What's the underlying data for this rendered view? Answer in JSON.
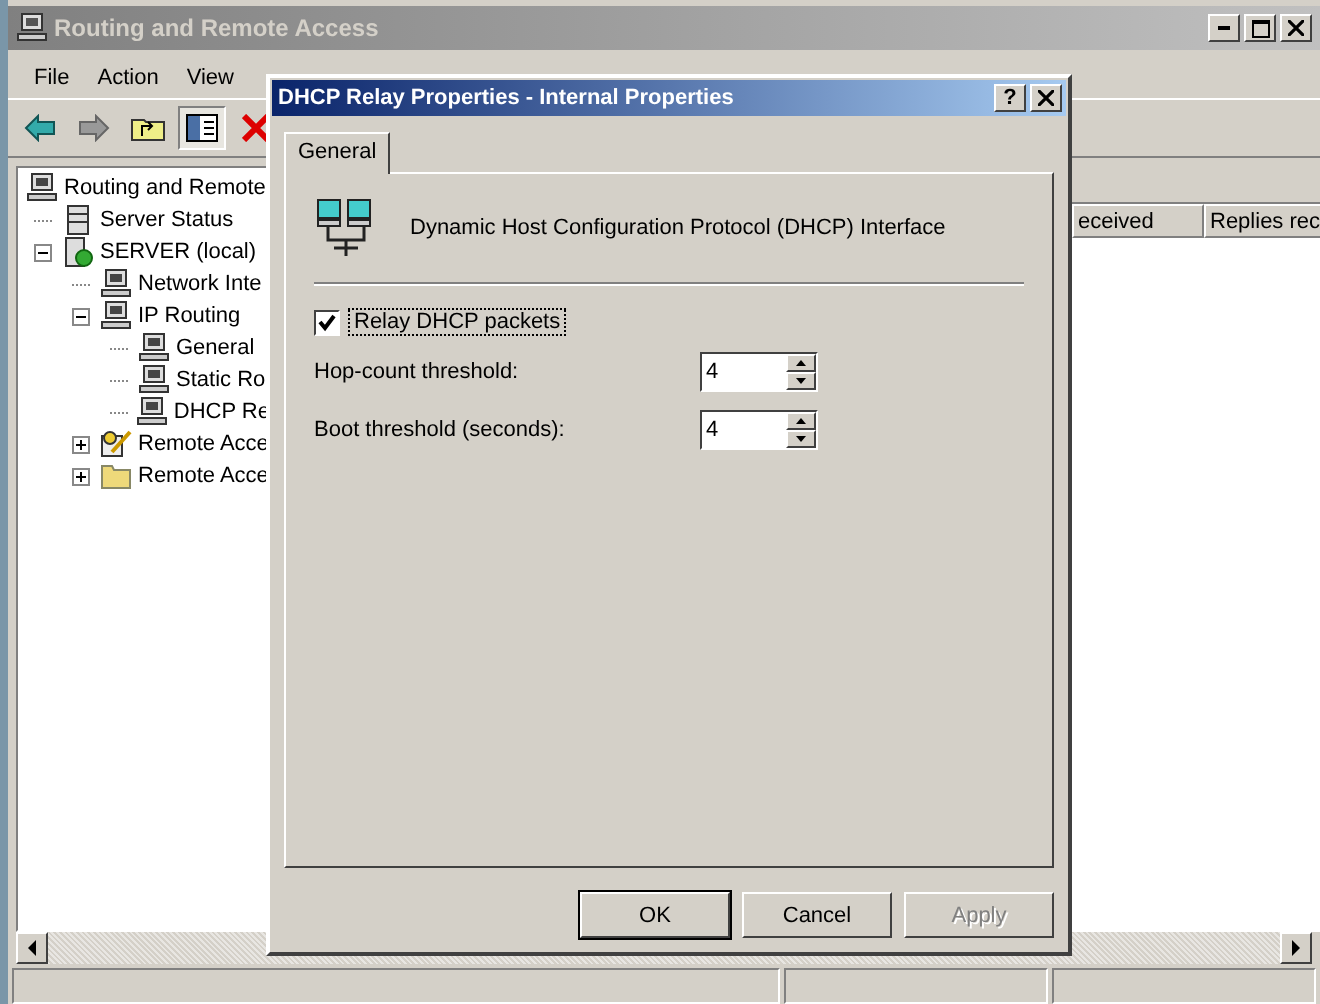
{
  "main_window": {
    "title": "Routing and Remote Access"
  },
  "menu": [
    "File",
    "Action",
    "View"
  ],
  "toolbar": [
    {
      "kind": "back",
      "pressed": false
    },
    {
      "kind": "forward",
      "pressed": false
    },
    {
      "kind": "up",
      "pressed": false
    },
    {
      "kind": "tree",
      "pressed": true
    },
    {
      "kind": "delete",
      "pressed": false
    }
  ],
  "tree": [
    {
      "label": "Routing and Remote",
      "kind": "computer",
      "children": [
        {
          "label": "Server Status",
          "kind": "status"
        },
        {
          "label": "SERVER (local)",
          "kind": "server",
          "expanded": true,
          "children": [
            {
              "label": "Network Inte",
              "kind": "computer"
            },
            {
              "label": "IP Routing",
              "kind": "computer",
              "expanded": true,
              "children": [
                {
                  "label": "General",
                  "kind": "computer"
                },
                {
                  "label": "Static Ro",
                  "kind": "computer"
                },
                {
                  "label": "DHCP Re",
                  "kind": "computer"
                }
              ]
            },
            {
              "label": "Remote Acce",
              "kind": "policy",
              "expanded": false
            },
            {
              "label": "Remote Acce",
              "kind": "folder",
              "expanded": false
            }
          ]
        }
      ]
    }
  ],
  "list_columns": [
    "eceived",
    "Replies rec"
  ],
  "dialog": {
    "title": "DHCP Relay Properties - Internal Properties",
    "help_button": "?",
    "tabs": [
      {
        "label": "General",
        "selected": true
      }
    ],
    "heading": "Dynamic Host Configuration Protocol (DHCP) Interface",
    "relay": {
      "label": "Relay DHCP packets",
      "checked": true
    },
    "fields": [
      {
        "label": "Hop-count threshold:",
        "value": "4"
      },
      {
        "label": "Boot threshold (seconds):",
        "value": "4"
      }
    ],
    "buttons": [
      {
        "label": "OK",
        "default": true,
        "disabled": false
      },
      {
        "label": "Cancel",
        "default": false,
        "disabled": false
      },
      {
        "label": "Apply",
        "default": false,
        "disabled": true
      }
    ]
  }
}
